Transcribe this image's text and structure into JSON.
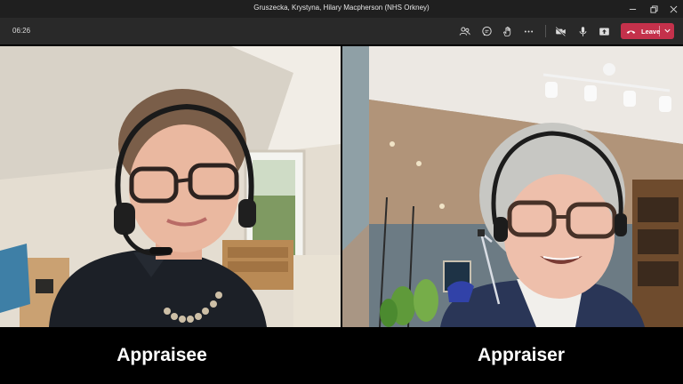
{
  "window": {
    "title": "Gruszecka, Krystyna, Hilary Macpherson (NHS Orkney)"
  },
  "meeting": {
    "elapsed": "06:26",
    "leave_label": "Leave"
  },
  "participants": [
    {
      "role_label": "Appraisee"
    },
    {
      "role_label": "Appraiser"
    }
  ],
  "colors": {
    "leave_button": "#c4314b",
    "toolbar": "#292929",
    "titlebar": "#1f1f1f"
  }
}
